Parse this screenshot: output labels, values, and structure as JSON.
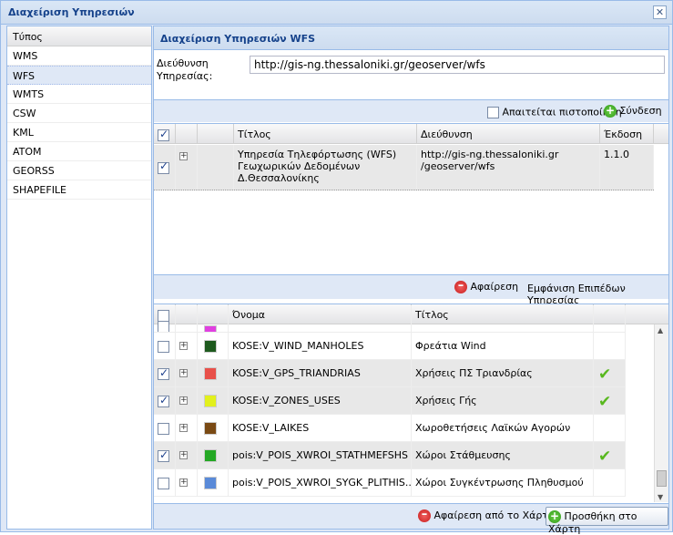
{
  "window": {
    "title": "Διαχείριση Υπηρεσιών"
  },
  "left_panel": {
    "header": "Τύπος",
    "items": [
      "WMS",
      "WFS",
      "WMTS",
      "CSW",
      "KML",
      "ATOM",
      "GEORSS",
      "SHAPEFILE"
    ],
    "selected": "WFS"
  },
  "right_panel": {
    "title": "Διαχείριση Υπηρεσιών WFS",
    "address_label": "Διεύθυνση Υπηρεσίας:",
    "address_value": "http://gis-ng.thessaloniki.gr/geoserver/wfs",
    "auth_label": "Απαιτείται πιστοποίηση",
    "connect_label": "Σύνδεση"
  },
  "services_grid": {
    "columns": [
      "Τίτλος",
      "Διεύθυνση",
      "Έκδοση"
    ],
    "rows": [
      {
        "title_lines": [
          "Υπηρεσία Τηλεφόρτωσης (WFS)",
          "Γεωχωρικών Δεδομένων",
          "Δ.Θεσσαλονίκης"
        ],
        "address_lines": [
          "http://gis-ng.thessaloniki.gr",
          "/geoserver/wfs"
        ],
        "version": "1.1.0",
        "checked": true
      }
    ],
    "remove_label": "Αφαίρεση",
    "show_layers_label": "Εμφάνιση Επιπέδων Υπηρεσίας"
  },
  "layers_grid": {
    "columns": [
      "Όνομα",
      "Τίτλος"
    ],
    "rows": [
      {
        "name": "KOSE:V_WIND_MANHOLES",
        "title": "Φρεάτια Wind",
        "color": "#1e5a1e",
        "checked": false,
        "added": false
      },
      {
        "name": "KOSE:V_GPS_TRIANDRIAS",
        "title": "Χρήσεις ΠΣ Τριανδρίας",
        "color": "#e8504a",
        "checked": true,
        "added": true
      },
      {
        "name": "KOSE:V_ZONES_USES",
        "title": "Χρήσεις Γής",
        "color": "#e2f01c",
        "checked": true,
        "added": true
      },
      {
        "name": "KOSE:V_LAIKES",
        "title": "Χωροθετήσεις Λαϊκών Αγορών",
        "color": "#7a4a14",
        "checked": false,
        "added": false
      },
      {
        "name": "pois:V_POIS_XWROI_STATHMEFSHS",
        "title": "Χώροι Στάθμευσης",
        "color": "#24a824",
        "checked": true,
        "added": true
      },
      {
        "name": "pois:V_POIS_XWROI_SYGK_PLITHIS...",
        "title": "Χώροι Συγκέντρωσης Πληθυσμού",
        "color": "#5a8ad8",
        "checked": false,
        "added": false
      }
    ],
    "partial_top_color": "#e040e0",
    "remove_from_map_label": "Αφαίρεση από το Χάρτη",
    "add_to_map_label": "Προσθήκη στο Χάρτη"
  }
}
